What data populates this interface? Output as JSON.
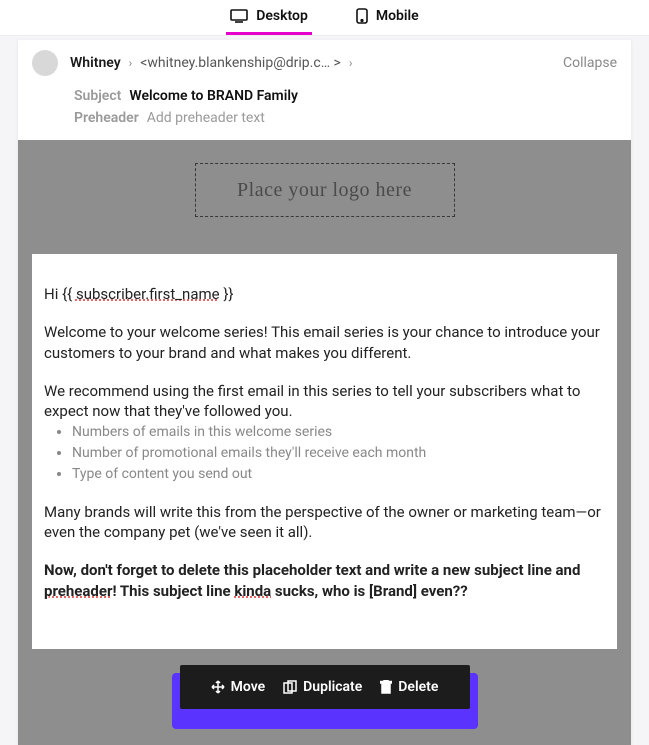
{
  "tabs": {
    "desktop": "Desktop",
    "mobile": "Mobile"
  },
  "header": {
    "from_name": "Whitney",
    "from_email": "<whitney.blankenship@drip.c… >",
    "collapse": "Collapse",
    "subject_label": "Subject",
    "subject_value": "Welcome to BRAND Family",
    "preheader_label": "Preheader",
    "preheader_placeholder": "Add preheader text"
  },
  "logo_slot": "Place your logo here",
  "body": {
    "greeting_prefix": "Hi {{ ",
    "merge_tag": "subscriber.first_name",
    "greeting_suffix": " }}",
    "para1": "Welcome to your welcome series! This email series is your chance to introduce your customers to your brand and what makes you different.",
    "para2": "We recommend using the first email in this series to tell your subscribers what to expect now that they've followed you.",
    "bullets": [
      "Numbers of emails in this welcome series",
      "Number of promotional emails they'll receive each month",
      "Type of content you send out"
    ],
    "para3": "Many brands will write this from the perspective of the owner or marketing team—or even the company pet (we've seen it all).",
    "para4_a": "Now, don't forget to delete this placeholder text and write a new subject line and ",
    "para4_preheader": "preheader",
    "para4_b": "! This subject line ",
    "para4_kinda": "kinda",
    "para4_c": " sucks, who is [Brand] even??"
  },
  "toolbar": {
    "move": "Move",
    "duplicate": "Duplicate",
    "delete": "Delete"
  }
}
